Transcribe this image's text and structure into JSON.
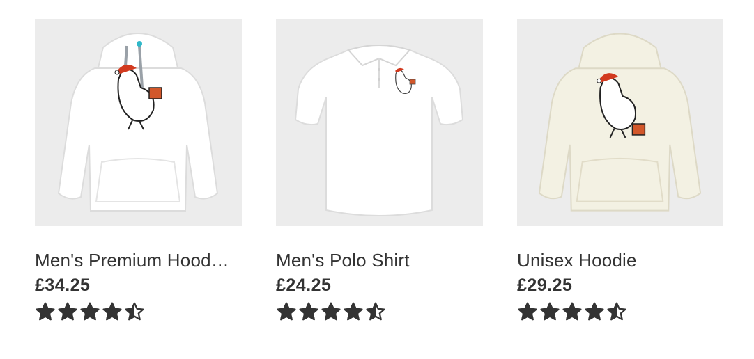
{
  "colors": {
    "text": "#333333",
    "tile_bg": "#ececec",
    "star": "#333333",
    "hoodie_white": "#ffffff",
    "hoodie_cream": "#f3f1e3",
    "drawstring": "#9aa1a8",
    "eyelet": "#2fb8c9",
    "santa_hat": "#d23a1f",
    "gift": "#d2572a"
  },
  "products": [
    {
      "name": "Men's Premium Hood…",
      "price": "£34.25",
      "rating": 4.5,
      "image_alt": "white premium hoodie with Christmas chicken print",
      "garment": "hoodie",
      "color_key": "hoodie_white"
    },
    {
      "name": "Men's Polo Shirt",
      "price": "£24.25",
      "rating": 4.5,
      "image_alt": "white polo shirt with small Christmas chicken print",
      "garment": "polo",
      "color_key": "hoodie_white"
    },
    {
      "name": "Unisex Hoodie",
      "price": "£29.25",
      "rating": 4.5,
      "image_alt": "cream unisex hoodie with Christmas chicken print",
      "garment": "hoodie",
      "color_key": "hoodie_cream"
    }
  ]
}
